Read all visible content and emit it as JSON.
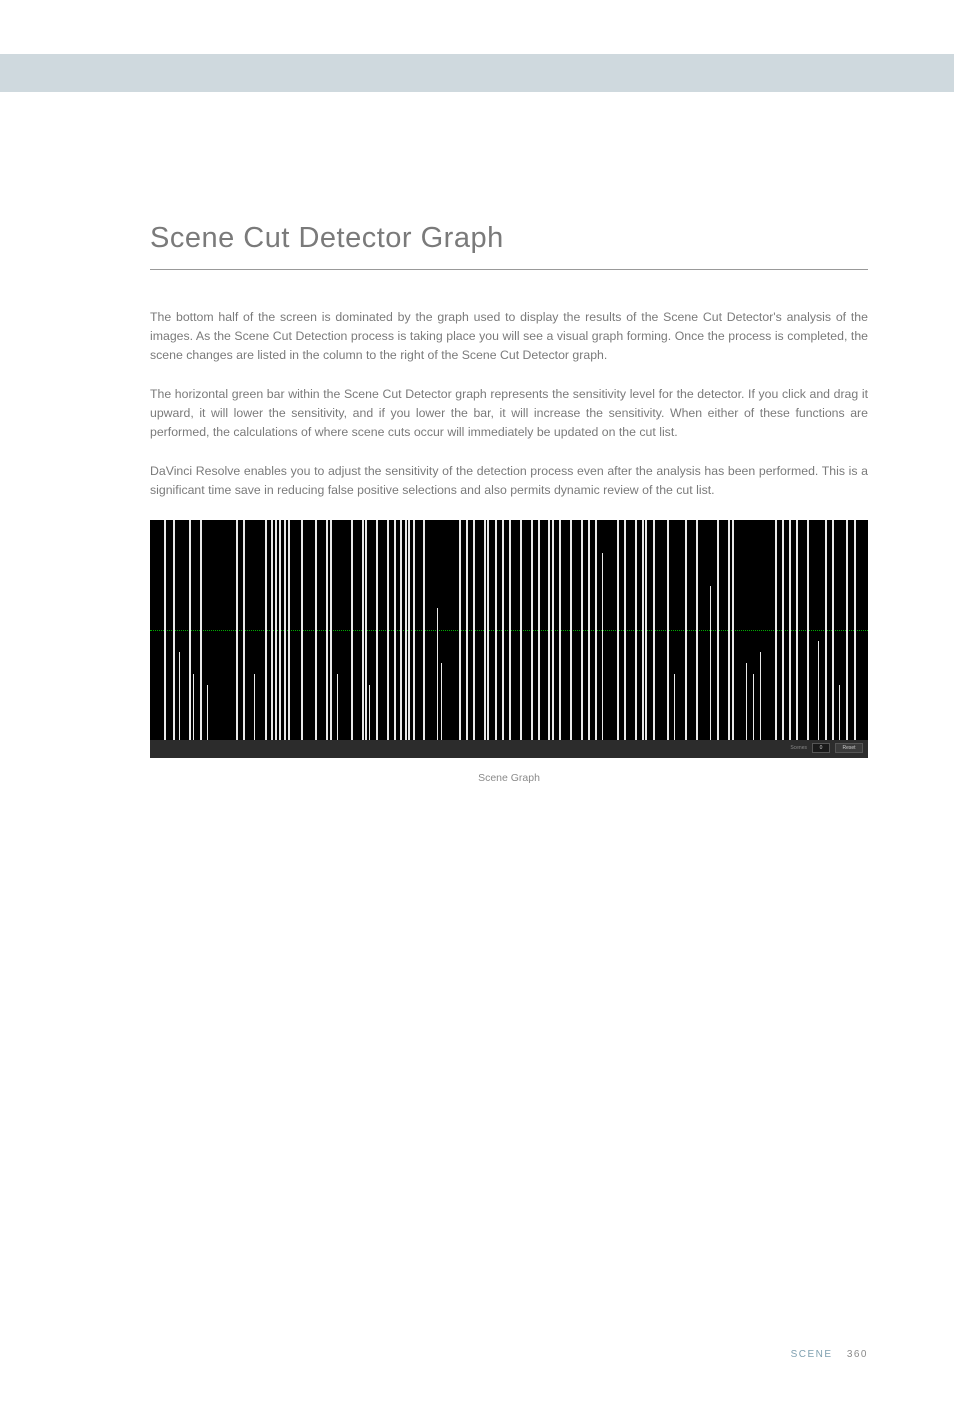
{
  "title": "Scene Cut Detector Graph",
  "paragraphs": {
    "p1": "The bottom half of the screen is dominated by the graph used to display the results of the Scene Cut Detector's analysis of the images.  As the Scene Cut Detection process is taking place you will see a visual graph forming. Once the process is completed, the scene changes are listed in the column to the right of the Scene Cut Detector graph.",
    "p2": "The horizontal green bar within the Scene Cut Detector graph represents the sensitivity level for the detector. If you click and drag it upward, it will lower the sensitivity, and if you lower the bar, it will increase the sensitivity. When either of these functions are performed, the calculations of where scene cuts occur will immediately be updated on the cut list.",
    "p3": "DaVinci Resolve enables you to adjust the sensitivity of the detection process even after the analysis has been performed. This is a significant time save in reducing false positive selections and also permits dynamic review of the cut list."
  },
  "graph": {
    "caption": "Scene Graph",
    "scenes_label": "Scenes",
    "scenes_value": "0",
    "reset_label": "Reset",
    "sensitivity_pct": 50
  },
  "chart_data": {
    "type": "bar",
    "title": "Scene Cut Detector Graph",
    "xlabel": "",
    "ylabel": "",
    "ylim": [
      0,
      100
    ],
    "sensitivity_line": 50,
    "bars": [
      {
        "x": 2.0,
        "h": 100
      },
      {
        "x": 3.2,
        "h": 100
      },
      {
        "x": 4.0,
        "h": 40
      },
      {
        "x": 5.5,
        "h": 100
      },
      {
        "x": 6.0,
        "h": 30
      },
      {
        "x": 7.0,
        "h": 100
      },
      {
        "x": 8.0,
        "h": 25
      },
      {
        "x": 12.0,
        "h": 100
      },
      {
        "x": 13.0,
        "h": 100
      },
      {
        "x": 14.5,
        "h": 30
      },
      {
        "x": 16.0,
        "h": 100
      },
      {
        "x": 16.8,
        "h": 100
      },
      {
        "x": 17.4,
        "h": 100
      },
      {
        "x": 18.0,
        "h": 100
      },
      {
        "x": 18.6,
        "h": 100
      },
      {
        "x": 19.2,
        "h": 100
      },
      {
        "x": 21.0,
        "h": 100
      },
      {
        "x": 23.0,
        "h": 100
      },
      {
        "x": 24.5,
        "h": 100
      },
      {
        "x": 25.0,
        "h": 100
      },
      {
        "x": 26.0,
        "h": 30
      },
      {
        "x": 28.0,
        "h": 100
      },
      {
        "x": 29.5,
        "h": 100
      },
      {
        "x": 30.0,
        "h": 100
      },
      {
        "x": 30.5,
        "h": 25
      },
      {
        "x": 31.5,
        "h": 100
      },
      {
        "x": 33.0,
        "h": 100
      },
      {
        "x": 34.0,
        "h": 100
      },
      {
        "x": 34.8,
        "h": 100
      },
      {
        "x": 35.5,
        "h": 100
      },
      {
        "x": 36.0,
        "h": 100
      },
      {
        "x": 36.6,
        "h": 100
      },
      {
        "x": 38.0,
        "h": 100
      },
      {
        "x": 40.0,
        "h": 60
      },
      {
        "x": 40.5,
        "h": 35
      },
      {
        "x": 43.0,
        "h": 100
      },
      {
        "x": 44.0,
        "h": 100
      },
      {
        "x": 45.0,
        "h": 100
      },
      {
        "x": 46.5,
        "h": 100
      },
      {
        "x": 47.0,
        "h": 100
      },
      {
        "x": 48.0,
        "h": 100
      },
      {
        "x": 49.0,
        "h": 100
      },
      {
        "x": 50.0,
        "h": 100
      },
      {
        "x": 51.5,
        "h": 100
      },
      {
        "x": 53.0,
        "h": 100
      },
      {
        "x": 54.0,
        "h": 100
      },
      {
        "x": 55.5,
        "h": 100
      },
      {
        "x": 56.0,
        "h": 100
      },
      {
        "x": 57.0,
        "h": 100
      },
      {
        "x": 58.5,
        "h": 100
      },
      {
        "x": 60.0,
        "h": 100
      },
      {
        "x": 61.0,
        "h": 100
      },
      {
        "x": 62.0,
        "h": 100
      },
      {
        "x": 63.0,
        "h": 85
      },
      {
        "x": 65.0,
        "h": 100
      },
      {
        "x": 66.0,
        "h": 100
      },
      {
        "x": 67.5,
        "h": 100
      },
      {
        "x": 68.5,
        "h": 100
      },
      {
        "x": 69.0,
        "h": 100
      },
      {
        "x": 70.0,
        "h": 100
      },
      {
        "x": 72.0,
        "h": 100
      },
      {
        "x": 73.0,
        "h": 30
      },
      {
        "x": 74.5,
        "h": 100
      },
      {
        "x": 76.0,
        "h": 100
      },
      {
        "x": 78.0,
        "h": 70
      },
      {
        "x": 79.0,
        "h": 100
      },
      {
        "x": 80.5,
        "h": 100
      },
      {
        "x": 81.0,
        "h": 100
      },
      {
        "x": 83.0,
        "h": 35
      },
      {
        "x": 84.0,
        "h": 30
      },
      {
        "x": 85.0,
        "h": 40
      },
      {
        "x": 87.0,
        "h": 100
      },
      {
        "x": 88.0,
        "h": 100
      },
      {
        "x": 89.0,
        "h": 100
      },
      {
        "x": 90.0,
        "h": 100
      },
      {
        "x": 91.5,
        "h": 100
      },
      {
        "x": 93.0,
        "h": 45
      },
      {
        "x": 94.0,
        "h": 100
      },
      {
        "x": 95.0,
        "h": 100
      },
      {
        "x": 96.0,
        "h": 25
      },
      {
        "x": 97.0,
        "h": 100
      },
      {
        "x": 98.0,
        "h": 100
      }
    ]
  },
  "footer": {
    "section": "SCENE",
    "page": "360"
  }
}
